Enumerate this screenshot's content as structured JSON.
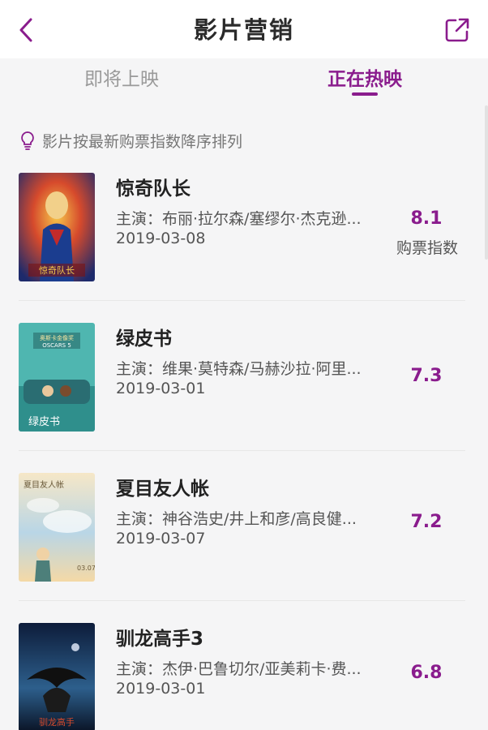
{
  "header": {
    "title": "影片营销"
  },
  "tabs": [
    {
      "label": "即将上映"
    },
    {
      "label": "正在热映"
    }
  ],
  "hint": {
    "text": "影片按最新购票指数降序排列"
  },
  "movies": [
    {
      "title": "惊奇队长",
      "cast": "主演：布丽·拉尔森/塞缪尔·杰克逊...",
      "date": "2019-03-08",
      "score": "8.1",
      "score_label": "购票指数",
      "poster_caption": "惊奇队长"
    },
    {
      "title": "绿皮书",
      "cast": "主演：维果·莫特森/马赫沙拉·阿里...",
      "date": "2019-03-01",
      "score": "7.3",
      "poster_caption": "绿皮书",
      "poster_badge": "奥斯卡金像奖",
      "poster_badge_sub": "OSCARS 5"
    },
    {
      "title": "夏目友人帐",
      "cast": "主演：神谷浩史/井上和彦/高良健...",
      "date": "2019-03-07",
      "score": "7.2",
      "poster_caption": "夏目友人帐",
      "poster_date": "03.07"
    },
    {
      "title": "驯龙高手3",
      "cast": "主演：杰伊·巴鲁切尔/亚美莉卡·费...",
      "date": "2019-03-01",
      "score": "6.8",
      "poster_caption": "驯龙高手"
    }
  ],
  "colors": {
    "accent": "#8a1c8d",
    "background": "#f5f5f6"
  }
}
